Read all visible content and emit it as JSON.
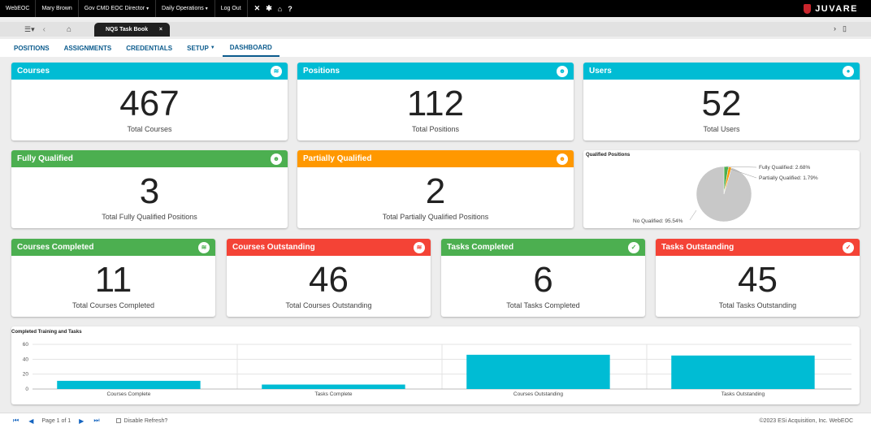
{
  "topbar": {
    "app": "WebEOC",
    "user": "Mary Brown",
    "position": "Gov CMD EOC Director",
    "incident": "Daily Operations",
    "logout": "Log Out",
    "icons": [
      "expand-icon",
      "gear-icon",
      "inbox-icon",
      "help-icon"
    ],
    "brand": "JUVARE"
  },
  "tabbar": {
    "tab_label": "NQS Task Book",
    "close": "×"
  },
  "nav": [
    "POSITIONS",
    "ASSIGNMENTS",
    "CREDENTIALS",
    "SETUP",
    "DASHBOARD"
  ],
  "nav_active": "DASHBOARD",
  "cards": {
    "courses": {
      "title": "Courses",
      "value": "467",
      "label": "Total Courses",
      "color": "#00bcd4"
    },
    "positions": {
      "title": "Positions",
      "value": "112",
      "label": "Total Positions",
      "color": "#00bcd4"
    },
    "users": {
      "title": "Users",
      "value": "52",
      "label": "Total Users",
      "color": "#00bcd4"
    },
    "fully": {
      "title": "Fully Qualified",
      "value": "3",
      "label": "Total Fully Qualified Positions",
      "color": "#4caf50"
    },
    "partially": {
      "title": "Partially Qualified",
      "value": "2",
      "label": "Total Partially Qualified Positions",
      "color": "#ff9800"
    },
    "courses_completed": {
      "title": "Courses Completed",
      "value": "11",
      "label": "Total Courses Completed",
      "color": "#4caf50"
    },
    "courses_outstanding": {
      "title": "Courses Outstanding",
      "value": "46",
      "label": "Total Courses Outstanding",
      "color": "#f44336"
    },
    "tasks_completed": {
      "title": "Tasks Completed",
      "value": "6",
      "label": "Total Tasks Completed",
      "color": "#4caf50"
    },
    "tasks_outstanding": {
      "title": "Tasks Outstanding",
      "value": "45",
      "label": "Total Tasks Outstanding",
      "color": "#f44336"
    }
  },
  "chart_data": [
    {
      "type": "pie",
      "title": "Qualified Positions",
      "slices": [
        {
          "label": "Fully Qualified: 2.68%",
          "value": 2.68,
          "color": "#4caf50"
        },
        {
          "label": "Partially Qualified: 1.79%",
          "value": 1.79,
          "color": "#ff9800"
        },
        {
          "label": "No Qualified: 95.54%",
          "value": 95.54,
          "color": "#c8c8c8"
        }
      ]
    },
    {
      "type": "bar",
      "title": "Completed Training and Tasks",
      "categories": [
        "Courses Complete",
        "Tasks Complete",
        "Courses Outstanding",
        "Tasks Outstanding"
      ],
      "values": [
        11,
        6,
        46,
        45
      ],
      "ylim": [
        0,
        60
      ],
      "yticks": [
        "0",
        "20",
        "40",
        "60"
      ],
      "color": "#00bcd4",
      "grid": true
    }
  ],
  "footer": {
    "page": "Page 1 of 1",
    "disable_refresh": "Disable Refresh?",
    "copyright": "©2023 ESi Acquisition, Inc. WebEOC"
  }
}
